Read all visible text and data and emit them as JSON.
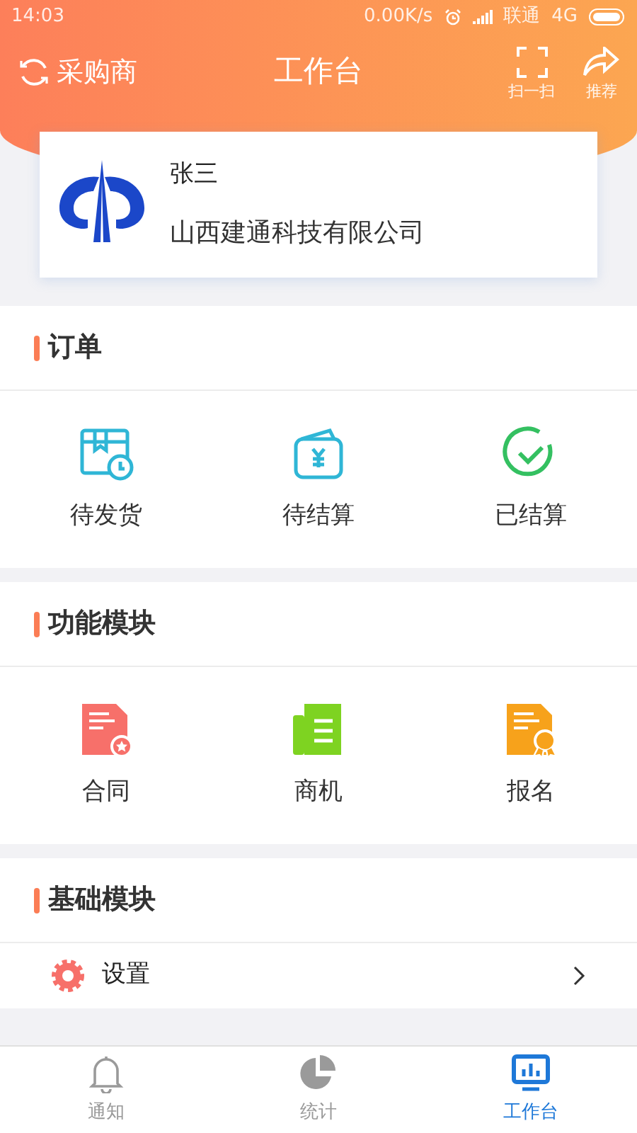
{
  "status_bar": {
    "time": "14:03",
    "speed": "0.00K/s",
    "carrier": "联通",
    "network": "4G"
  },
  "header": {
    "role": "采购商",
    "title": "工作台",
    "actions": [
      {
        "kind": "scan",
        "label": "扫一扫"
      },
      {
        "kind": "share",
        "label": "推荐"
      }
    ]
  },
  "profile": {
    "name": "张三",
    "company": "山西建通科技有限公司"
  },
  "sections": [
    {
      "title": "订单",
      "items": [
        {
          "kind": "box",
          "label": "待发货"
        },
        {
          "kind": "wallet",
          "label": "待结算"
        },
        {
          "kind": "check",
          "label": "已结算"
        }
      ]
    },
    {
      "title": "功能模块",
      "items": [
        {
          "kind": "contract",
          "label": "合同"
        },
        {
          "kind": "doc",
          "label": "商机"
        },
        {
          "kind": "award",
          "label": "报名"
        }
      ]
    },
    {
      "title": "基础模块",
      "rows": [
        {
          "label": "设置"
        }
      ]
    }
  ],
  "tab_bar": [
    {
      "kind": "bell",
      "label": "通知",
      "selected": false
    },
    {
      "kind": "pie",
      "label": "统计",
      "selected": false
    },
    {
      "kind": "board",
      "label": "工作台",
      "selected": true
    }
  ]
}
